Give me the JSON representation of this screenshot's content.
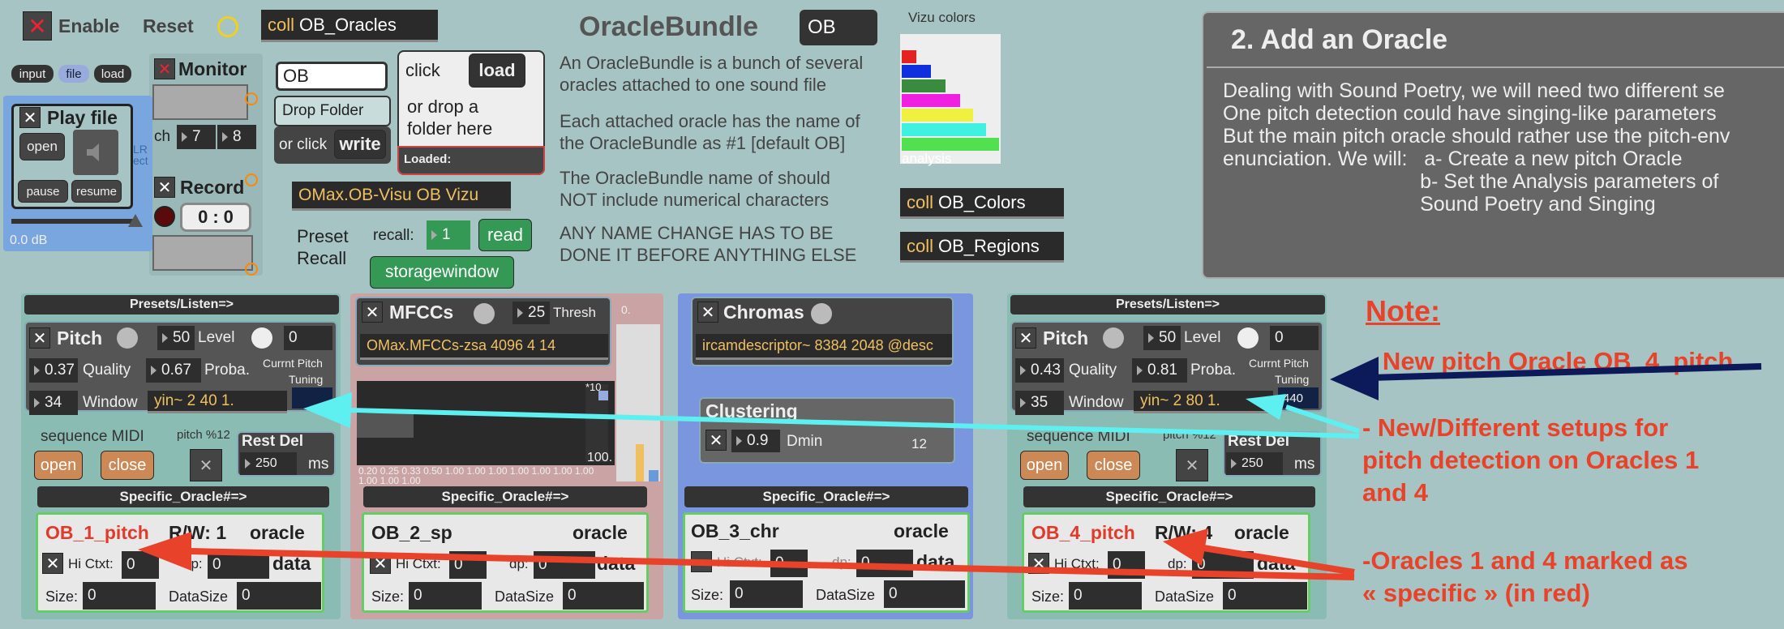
{
  "top": {
    "enable": "Enable",
    "reset": "Reset",
    "coll_kw": "coll",
    "coll_oracles": "OB_Oracles",
    "input": "input",
    "file": "file",
    "load": "load"
  },
  "monitor": {
    "title": "Monitor",
    "ch": "ch",
    "ch1": "7",
    "ch2": "8"
  },
  "play": {
    "title": "Play file",
    "open": "open",
    "pause": "pause",
    "resume": "resume",
    "db": "0.0 dB",
    "side1": "LR",
    "side2": "ect"
  },
  "record": {
    "title": "Record",
    "min": "0",
    "sec": "0"
  },
  "loader": {
    "name_value": "OB",
    "drop_folder": "Drop Folder",
    "or_click": "or click",
    "write": "write",
    "click": "click",
    "load": "load",
    "drop_hint": "or drop a\nfolder here",
    "loaded": "Loaded:"
  },
  "visu": {
    "label": "OMax.OB-Visu OB Vizu"
  },
  "preset": {
    "label": "Preset\nRecall",
    "recall": "recall:",
    "num": "1",
    "read": "read",
    "storage": "storagewindow"
  },
  "bundle": {
    "title": "OracleBundle",
    "name": "OB",
    "p1": "An OracleBundle is a bunch of several\noracles attached to one sound file",
    "p2": "Each attached oracle has the name of\nthe OracleBundle as #1 [default OB]",
    "p3": "The OracleBundle name of should\nNOT include numerical characters",
    "p4": "ANY NAME CHANGE HAS TO BE\nDONE IT BEFORE ANYTHING ELSE"
  },
  "vizu": {
    "title": "Vizu colors",
    "analysis": "analysis",
    "colors": [
      "#e32222",
      "#1030e0",
      "#3a8a40",
      "#f020e0",
      "#f0f040",
      "#40f0e0",
      "#50e050"
    ],
    "coll_colors": "OB_Colors",
    "coll_regions": "OB_Regions"
  },
  "add": {
    "title": "2. Add an Oracle",
    "body": "Dealing with Sound Poetry, we will need two different se\nOne pitch detection could have singing-like parameters\nBut the main pitch oracle should rather use the pitch-env\nenunciation. We will:   a- Create a new pitch Oracle\n                                   b- Set the Analysis parameters of\n                                   Sound Poetry and Singing"
  },
  "col1": {
    "presets": "Presets/Listen=>",
    "pitch": "Pitch",
    "v50": "50",
    "level": "Level",
    "lv": "0",
    "quality_v": "0.37",
    "quality": "Quality",
    "proba_v": "0.67",
    "proba": "Proba.",
    "currnt": "Currnt Pitch",
    "tuning": "Tuning",
    "window_v": "34",
    "window": "Window",
    "yin": "yin~ 2 40 1.",
    "seq": "sequence MIDI",
    "pitch12": "pitch %12",
    "open": "open",
    "close": "close",
    "rest": "Rest Del",
    "rest_v": "250",
    "ms": "ms",
    "specific": "Specific_Oracle#=>",
    "name": "OB_1_pitch",
    "rw": "R/W: 1",
    "oracle": "oracle",
    "hictx": "Hi Ctxt:",
    "hv": "0",
    "dp": "dp:",
    "dv": "0",
    "data": "data",
    "size": "Size:",
    "size_v": "0",
    "dsize": "DataSize",
    "dsize_v": "0"
  },
  "col2": {
    "title": "MFCCs",
    "v25": "25",
    "thresh": "Thresh",
    "obj": "OMax.MFCCs-zsa 4096 4 14",
    "scale": "0.20 0.25 0.33 0.50 1.00 1.00 1.00 1.00 1.00 1.00 1.00",
    "scale2": "1.00 1.00 1.00",
    "x10": "*10",
    "v100": "100.",
    "zero": "0.",
    "specific": "Specific_Oracle#=>",
    "name": "OB_2_sp",
    "oracle": "oracle",
    "hictx": "Hi Ctxt:",
    "hv": "0",
    "dp": "dp:",
    "dv": "0",
    "data": "data",
    "size": "Size:",
    "size_v": "0",
    "dsize": "DataSize",
    "dsize_v": "0"
  },
  "col3": {
    "title": "Chromas",
    "obj": "ircamdescriptor~ 8384 2048 @desc",
    "clustering": "Clustering",
    "dmin_v": "0.9",
    "dmin": "Dmin",
    "v12": "12",
    "specific": "Specific_Oracle#=>",
    "name": "OB_3_chr",
    "oracle": "oracle",
    "hictx": "Hi Ctxt:",
    "hv": "0",
    "dp": "dp:",
    "dv": "0",
    "data": "data",
    "size": "Size:",
    "size_v": "0",
    "dsize": "DataSize",
    "dsize_v": "0"
  },
  "col4": {
    "presets": "Presets/Listen=>",
    "pitch": "Pitch",
    "v50": "50",
    "level": "Level",
    "lv": "0",
    "quality_v": "0.43",
    "quality": "Quality",
    "proba_v": "0.81",
    "proba": "Proba.",
    "currnt": "Currnt Pitch",
    "tuning": "Tuning",
    "tune_v": "440",
    "window_v": "35",
    "window": "Window",
    "yin": "yin~ 2 80 1.",
    "seq": "sequence MIDI",
    "pitch12": "pitch %12",
    "open": "open",
    "close": "close",
    "rest": "Rest Del",
    "rest_v": "250",
    "ms": "ms",
    "specific": "Specific_Oracle#=>",
    "name": "OB_4_pitch",
    "rw": "R/W: 4",
    "oracle": "oracle",
    "hictx": "Hi Ctxt:",
    "hv": "0",
    "dp": "dp:",
    "dv": "0",
    "data": "data",
    "size": "Size:",
    "size_v": "0",
    "dsize": "DataSize",
    "dsize_v": "0"
  },
  "notes": {
    "title": "Note:",
    "n1": "- New pitch Oracle OB_4_pitch",
    "n2": "- New/Different setups for\npitch detection on Oracles 1\nand 4",
    "n3": "-Oracles 1 and 4 marked as\n« specific » (in red)"
  }
}
